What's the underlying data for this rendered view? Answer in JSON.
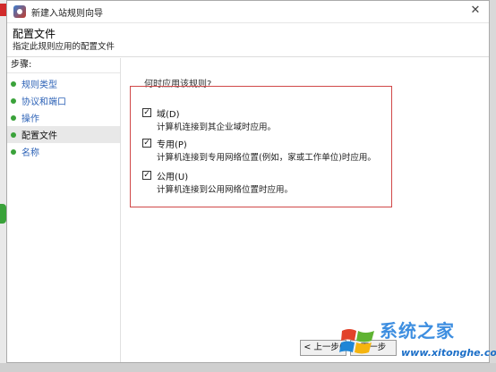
{
  "window": {
    "title": "新建入站规则向导",
    "close_glyph": "✕"
  },
  "header": {
    "title": "配置文件",
    "subtitle": "指定此规则应用的配置文件"
  },
  "sidebar": {
    "steps_label": "步骤:",
    "items": [
      {
        "label": "规则类型"
      },
      {
        "label": "协议和端口"
      },
      {
        "label": "操作"
      },
      {
        "label": "配置文件",
        "current": true
      },
      {
        "label": "名称"
      }
    ]
  },
  "main": {
    "question": "何时应用该规则?",
    "options": [
      {
        "name": "域(D)",
        "description": "计算机连接到其企业域时应用。",
        "checked": true
      },
      {
        "name": "专用(P)",
        "description": "计算机连接到专用网络位置(例如，家或工作单位)时应用。",
        "checked": true
      },
      {
        "name": "公用(U)",
        "description": "计算机连接到公用网络位置时应用。",
        "checked": true
      }
    ],
    "back_button": "< 上一步(",
    "next_button": "下一步"
  },
  "watermark": {
    "title": "系统之家",
    "url": "www.xitonghe.com"
  },
  "colors": {
    "highlight_box": "#d04848",
    "step_link": "#2e63b7",
    "step_dot": "#3aa23a"
  }
}
